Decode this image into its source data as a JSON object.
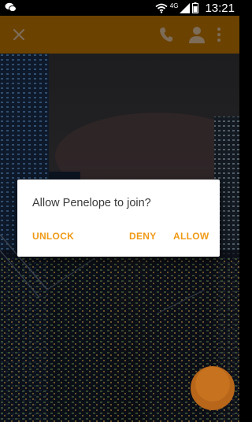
{
  "status_bar": {
    "network_label": "4G",
    "time": "13:21"
  },
  "toolbar": {
    "accent_color": "#6b4200"
  },
  "dialog": {
    "message": "Allow Penelope to join?",
    "unlock_label": "UNLOCK",
    "deny_label": "DENY",
    "allow_label": "ALLOW",
    "button_color": "#f09a17"
  },
  "icons": [
    "chat-icon",
    "wifi-icon",
    "signal-icon",
    "battery-icon",
    "close-icon",
    "phone-icon",
    "person-icon",
    "more-vert-icon"
  ]
}
